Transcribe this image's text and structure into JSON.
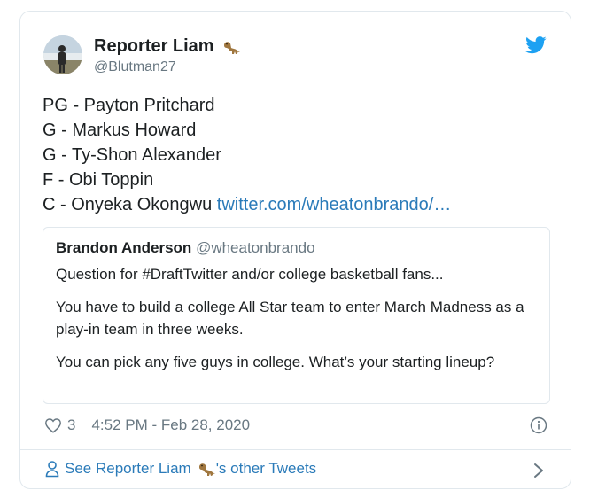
{
  "tweet": {
    "author_name": "Reporter Liam",
    "author_handle": "@Blutman27",
    "lines": [
      "PG - Payton Pritchard",
      "G - Markus Howard",
      "G - Ty-Shon Alexander",
      "F - Obi Toppin",
      "C - Onyeka Okongwu"
    ],
    "link_text": "twitter.com/wheatonbrando/…"
  },
  "quoted_tweet": {
    "author_name": "Brandon Anderson",
    "author_handle": "@wheatonbrando",
    "paragraphs": [
      "Question for #DraftTwitter and/or college basketball fans...",
      "You have to build a college All Star team to enter March Madness as a play-in team in three weeks.",
      "You can pick any five guys in college. What’s your starting lineup?"
    ]
  },
  "meta": {
    "likes": "3",
    "timestamp": "4:52 PM - Feb 28, 2020"
  },
  "footer": {
    "prefix": "See Reporter Liam",
    "suffix": "'s other Tweets"
  },
  "icons": {
    "twitter": "twitter-bird-icon",
    "like": "heart-icon",
    "info": "info-icon",
    "profile": "person-icon",
    "chevron": "chevron-right-icon",
    "emoji": "dinosaur-emoji-icon"
  },
  "colors": {
    "twitter_blue": "#1da1f2",
    "link": "#2b7bb9",
    "muted": "#697882",
    "text": "#1c2022",
    "border": "#e1e8ed"
  }
}
